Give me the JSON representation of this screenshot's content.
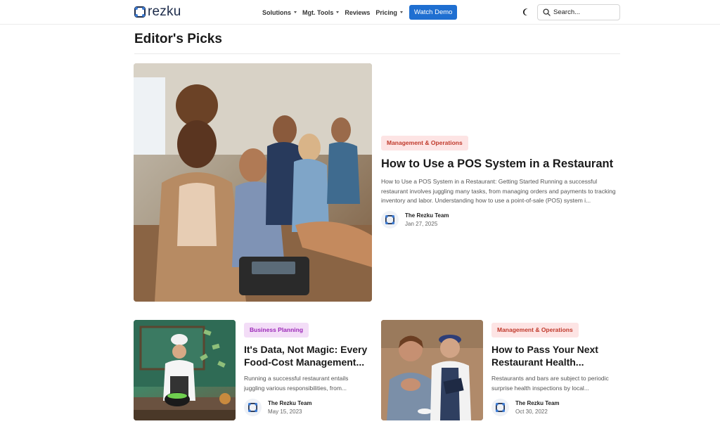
{
  "brand": {
    "name": "rezku",
    "accent": "#1f6fd1"
  },
  "nav": {
    "items": [
      {
        "label": "Solutions",
        "dropdown": true
      },
      {
        "label": "Mgt. Tools",
        "dropdown": true
      },
      {
        "label": "Reviews",
        "dropdown": false
      },
      {
        "label": "Pricing",
        "dropdown": true
      }
    ],
    "cta_label": "Watch Demo"
  },
  "theme_toggle_icon": "moon-icon",
  "search": {
    "placeholder": "Search...",
    "icon": "search-icon"
  },
  "section": {
    "title": "Editor's Picks"
  },
  "featured": {
    "category": "Management & Operations",
    "title": "How to Use a POS System in a Restaurant",
    "excerpt": "How to Use a POS System in a Restaurant: Getting Started Running a successful restaurant involves juggling many tasks, from managing orders and payments to tracking inventory and labor. Understanding how to use a point-of-sale (POS) system i...",
    "author": "The Rezku Team",
    "date": "Jan 27, 2025"
  },
  "cards": [
    {
      "category": "Business Planning",
      "title": "It's Data, Not Magic: Every Food-Cost Management...",
      "excerpt": "Running a successful restaurant entails juggling various responsibilities, from...",
      "author": "The Rezku Team",
      "date": "May 15, 2023"
    },
    {
      "category": "Management & Operations",
      "title": "How to Pass Your Next Restaurant Health...",
      "excerpt": "Restaurants and bars are subject to periodic surprise health inspections by local...",
      "author": "The Rezku Team",
      "date": "Oct 30, 2022"
    }
  ]
}
